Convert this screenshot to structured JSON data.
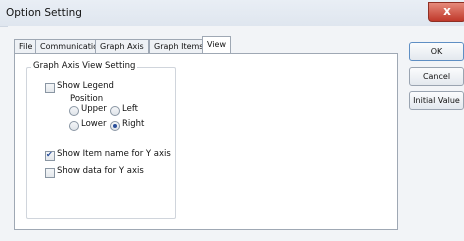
{
  "window": {
    "title": "Option Setting",
    "close_glyph": "x"
  },
  "tabs": [
    "File",
    "Communication",
    "Graph Axis",
    "Graph Items",
    "View"
  ],
  "active_tab": "View",
  "group": {
    "label": "Graph Axis View Setting",
    "show_legend": {
      "label": "Show Legend",
      "checked": false
    },
    "position": {
      "label": "Position",
      "options": [
        {
          "label": "Upper",
          "checked": false
        },
        {
          "label": "Left",
          "checked": false
        },
        {
          "label": "Lower",
          "checked": false
        },
        {
          "label": "Right",
          "checked": true
        }
      ]
    },
    "show_item_name": {
      "label": "Show Item name for Y axis",
      "checked": true
    },
    "show_data": {
      "label": "Show data for Y axis",
      "checked": false
    }
  },
  "buttons": {
    "ok": "OK",
    "cancel": "Cancel",
    "initial_value": "Initial Value"
  }
}
